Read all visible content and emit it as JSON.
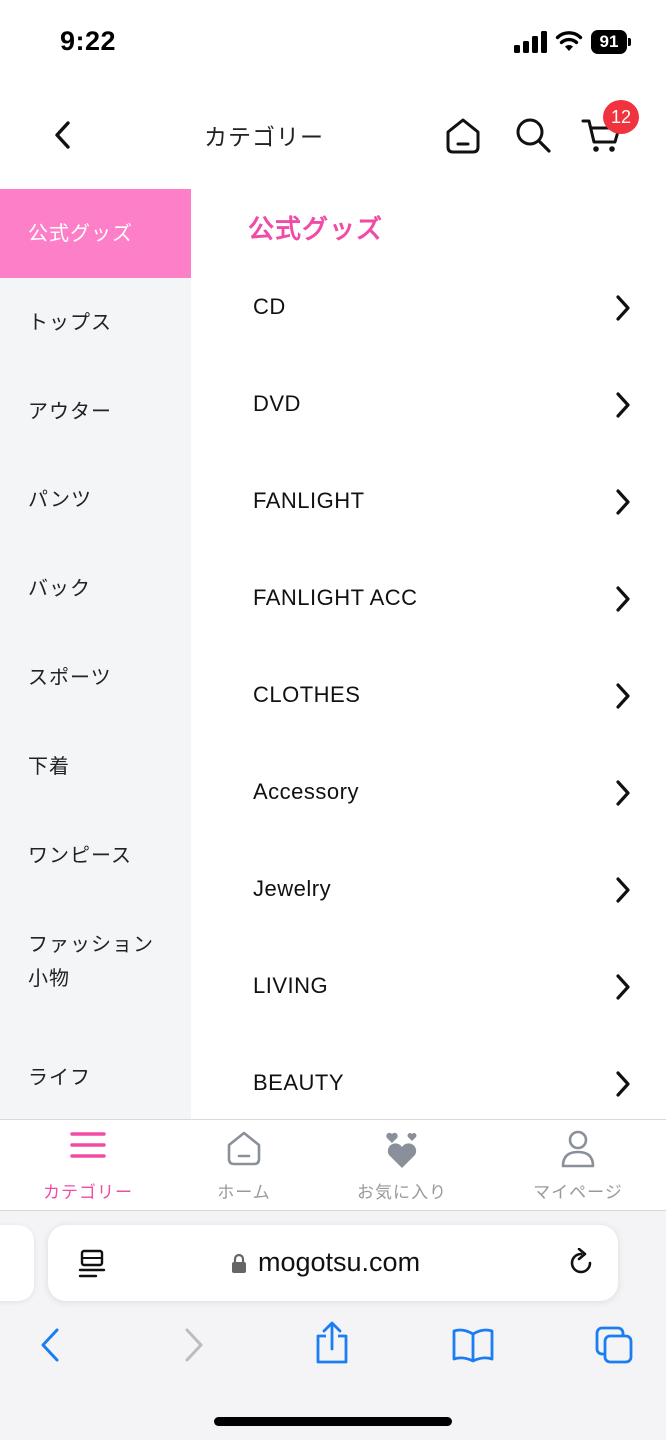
{
  "status_bar": {
    "time": "9:22",
    "battery": "91"
  },
  "header": {
    "title": "カテゴリー",
    "cart_count": "12"
  },
  "sidebar": {
    "items": [
      {
        "label": "公式グッズ",
        "active": true
      },
      {
        "label": "トップス"
      },
      {
        "label": "アウター"
      },
      {
        "label": "パンツ"
      },
      {
        "label": "バック"
      },
      {
        "label": "スポーツ"
      },
      {
        "label": "下着"
      },
      {
        "label": "ワンピース"
      },
      {
        "label_line1": "ファッション",
        "label_line2": "小物"
      },
      {
        "label": "ライフ"
      }
    ]
  },
  "main": {
    "section_title": "公式グッズ",
    "subcategories": [
      "CD",
      "DVD",
      "FANLIGHT",
      "FANLIGHT ACC",
      "CLOTHES",
      "Accessory",
      "Jewelry",
      "LIVING",
      "BEAUTY"
    ]
  },
  "bottom_tabs": [
    {
      "label": "カテゴリー",
      "icon": "menu-icon",
      "active": true
    },
    {
      "label": "ホーム",
      "icon": "home-icon"
    },
    {
      "label": "お気に入り",
      "icon": "hearts-icon"
    },
    {
      "label": "マイページ",
      "icon": "person-icon"
    }
  ],
  "browser": {
    "url": "mogotsu.com"
  },
  "colors": {
    "accent_pink": "#f04ba6",
    "sidebar_active": "#fd7fc8",
    "badge_red": "#f0333f",
    "safari_blue": "#1a7ef2"
  }
}
